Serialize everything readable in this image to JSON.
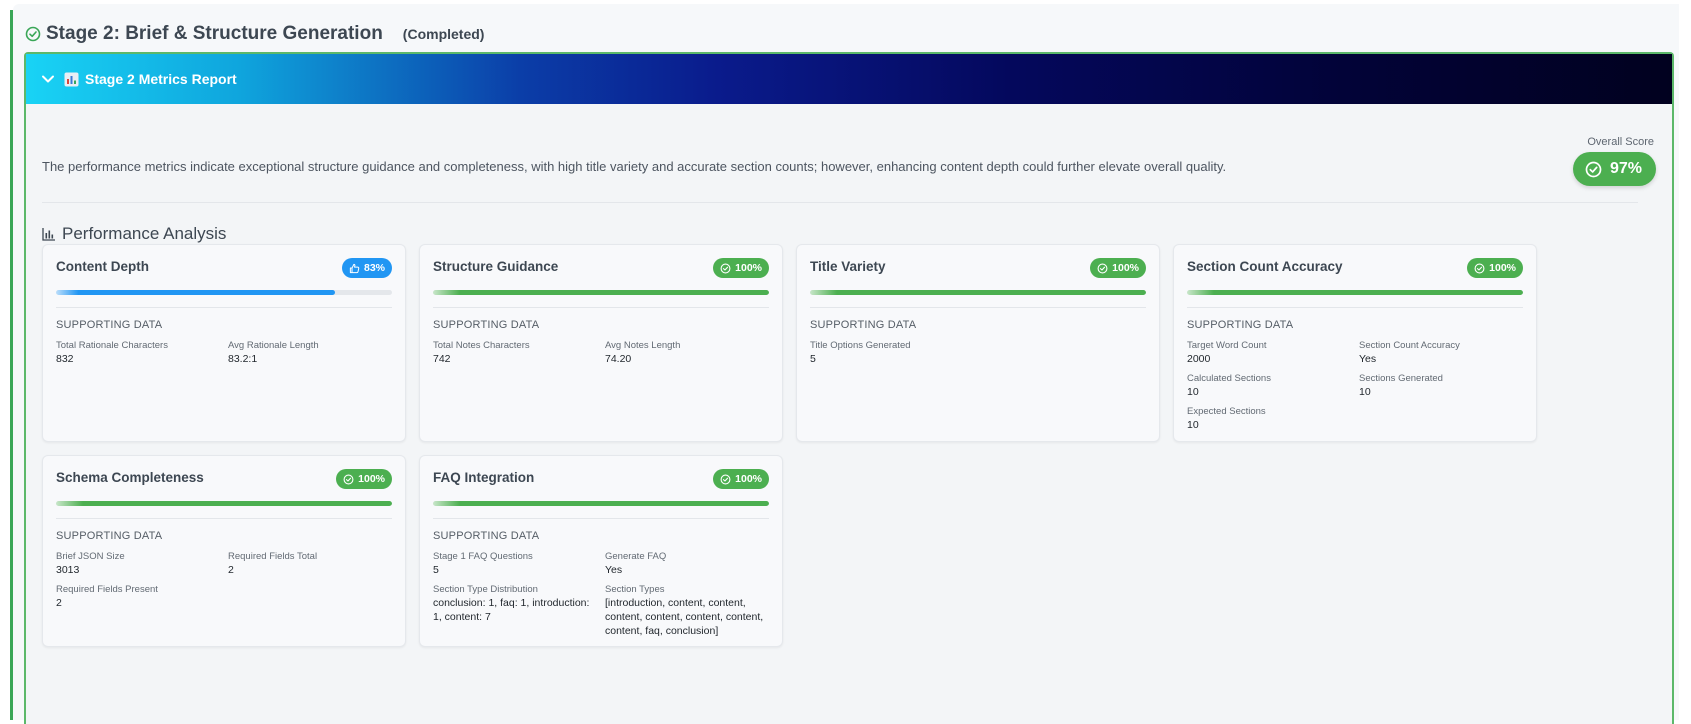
{
  "stage": {
    "title": "Stage 2: Brief & Structure Generation",
    "status": "(Completed)"
  },
  "report": {
    "title": "Stage 2 Metrics Report",
    "summary": "The performance metrics indicate exceptional structure guidance and completeness, with high title variety and accurate section counts; however, enhancing content depth could further elevate overall quality.",
    "overall_label": "Overall Score",
    "overall_score": "97%"
  },
  "performance": {
    "title": "Performance Analysis"
  },
  "supporting_label": "SUPPORTING DATA",
  "cards": [
    {
      "title": "Content Depth",
      "score": "83%",
      "progress": 0.83,
      "badge_color": "blue",
      "items": [
        {
          "k": "Total Rationale Characters",
          "v": "832"
        },
        {
          "k": "Avg Rationale Length",
          "v": "83.2:1"
        }
      ]
    },
    {
      "title": "Structure Guidance",
      "score": "100%",
      "progress": 1.0,
      "badge_color": "green",
      "items": [
        {
          "k": "Total Notes Characters",
          "v": "742"
        },
        {
          "k": "Avg Notes Length",
          "v": "74.20"
        }
      ]
    },
    {
      "title": "Title Variety",
      "score": "100%",
      "progress": 1.0,
      "badge_color": "green",
      "items": [
        {
          "k": "Title Options Generated",
          "v": "5"
        }
      ]
    },
    {
      "title": "Section Count Accuracy",
      "score": "100%",
      "progress": 1.0,
      "badge_color": "green",
      "items": [
        {
          "k": "Target Word Count",
          "v": "2000"
        },
        {
          "k": "Section Count Accuracy",
          "v": "Yes"
        },
        {
          "k": "Calculated Sections",
          "v": "10"
        },
        {
          "k": "Sections Generated",
          "v": "10"
        },
        {
          "k": "Expected Sections",
          "v": "10"
        }
      ]
    },
    {
      "title": "Schema Completeness",
      "score": "100%",
      "progress": 1.0,
      "badge_color": "green",
      "items": [
        {
          "k": "Brief JSON Size",
          "v": "3013"
        },
        {
          "k": "Required Fields Total",
          "v": "2"
        },
        {
          "k": "Required Fields Present",
          "v": "2"
        }
      ]
    },
    {
      "title": "FAQ Integration",
      "score": "100%",
      "progress": 1.0,
      "badge_color": "green",
      "items": [
        {
          "k": "Stage 1 FAQ Questions",
          "v": "5"
        },
        {
          "k": "Generate FAQ",
          "v": "Yes"
        },
        {
          "k": "Section Type Distribution",
          "v": "conclusion: 1, faq: 1, introduction: 1, content: 7"
        },
        {
          "k": "Section Types",
          "v": "[introduction, content, content, content, content, content, content, content, faq, conclusion]"
        }
      ]
    }
  ],
  "colors": {
    "green": "#4caf50",
    "blue": "#2196f3",
    "stage_border": "#3aa657"
  },
  "icons": {
    "stage": "check-circle-icon",
    "toggle": "chevron-down-icon",
    "report": "bar-chart-emoji-icon",
    "perf": "bar-chart-icon",
    "good": "check-circle-icon",
    "fair": "thumbs-up-icon"
  }
}
